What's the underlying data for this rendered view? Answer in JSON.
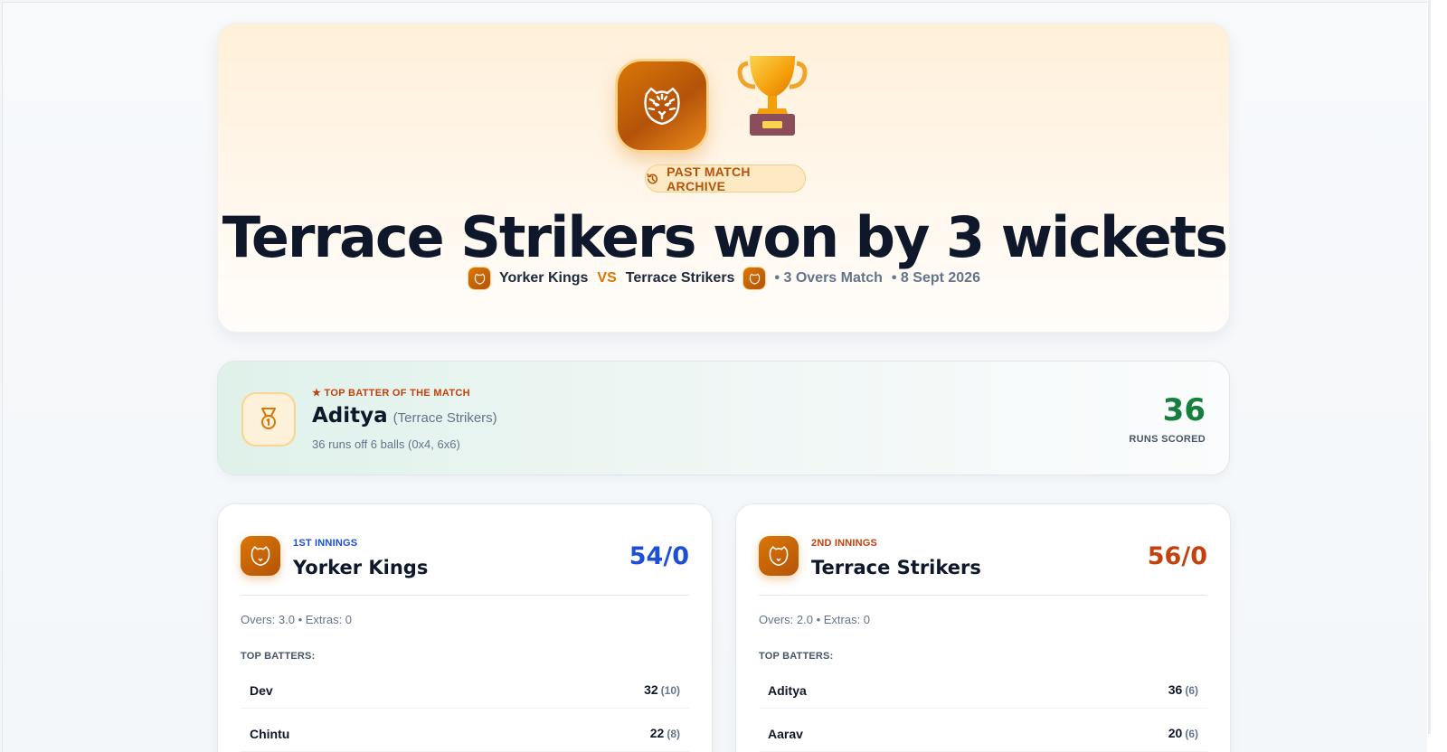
{
  "hero": {
    "archive_label": "PAST MATCH ARCHIVE",
    "result_title": "Terrace Strikers won by 3 wickets",
    "team_a": "Yorker Kings",
    "vs": "VS",
    "team_b": "Terrace Strikers",
    "format": "• 3 Overs Match",
    "date": "• 8 Sept 2026"
  },
  "top_batter": {
    "kicker": "★ TOP BATTER OF THE MATCH",
    "name": "Aditya",
    "team": "(Terrace Strikers)",
    "detail": "36 runs off 6 balls (0x4, 6x6)",
    "runs": "36",
    "runs_label": "RUNS SCORED"
  },
  "innings": [
    {
      "kicker": "1ST INNINGS",
      "team": "Yorker Kings",
      "score": "54/0",
      "overs_extras": "Overs: 3.0 • Extras: 0",
      "top_batters_label": "TOP BATTERS:",
      "batters": [
        {
          "name": "Dev",
          "runs": "32",
          "balls": "(10)"
        },
        {
          "name": "Chintu",
          "runs": "22",
          "balls": "(8)"
        }
      ]
    },
    {
      "kicker": "2ND INNINGS",
      "team": "Terrace Strikers",
      "score": "56/0",
      "overs_extras": "Overs: 2.0 • Extras: 0",
      "top_batters_label": "TOP BATTERS:",
      "batters": [
        {
          "name": "Aditya",
          "runs": "36",
          "balls": "(6)"
        },
        {
          "name": "Aarav",
          "runs": "20",
          "balls": "(6)"
        }
      ]
    }
  ],
  "colors": {
    "accent_orange": "#d97706",
    "first_innings": "#1d4ed8",
    "second_innings": "#c2410c",
    "top_runs": "#15803d"
  },
  "icons": [
    "tiger-icon",
    "trophy-icon",
    "history-icon",
    "medal-icon"
  ]
}
